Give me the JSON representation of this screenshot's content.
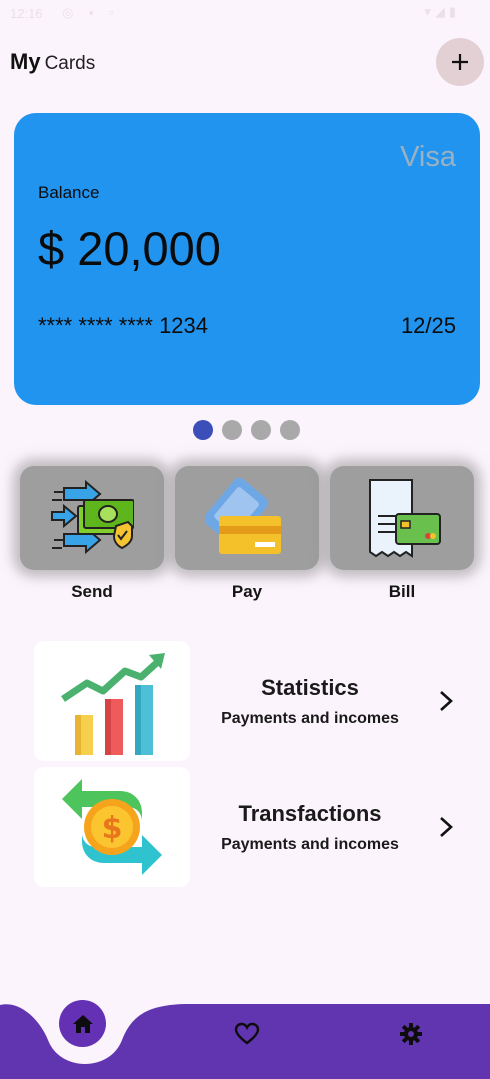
{
  "status_bar": {
    "time": "12:16",
    "left_icons": "◎ ▪ ▫",
    "right_icons": "▾◢▮"
  },
  "header": {
    "title_bold": "My",
    "title_rest": "Cards",
    "add_icon": "plus-icon"
  },
  "card": {
    "brand": "Visa",
    "balance_label": "Balance",
    "balance_value": "$ 20,000",
    "number": "**** **** **** 1234",
    "expiry": "12/25",
    "color": "#2194f0"
  },
  "carousel": {
    "count": 4,
    "active_index": 0
  },
  "actions": [
    {
      "label": "Send",
      "icon": "send-money-icon"
    },
    {
      "label": "Pay",
      "icon": "card-pay-icon"
    },
    {
      "label": "Bill",
      "icon": "bill-icon"
    }
  ],
  "features": [
    {
      "title": "Statistics",
      "subtitle": "Payments and incomes",
      "icon": "bar-chart-icon"
    },
    {
      "title": "Transfactions",
      "subtitle": "Payments and incomes",
      "icon": "currency-exchange-icon"
    }
  ],
  "bottom_nav": {
    "color": "#6135b0",
    "items": [
      {
        "name": "home",
        "icon": "home-icon",
        "active": true
      },
      {
        "name": "favorites",
        "icon": "heart-icon",
        "active": false
      },
      {
        "name": "settings",
        "icon": "gear-icon",
        "active": false
      }
    ]
  }
}
